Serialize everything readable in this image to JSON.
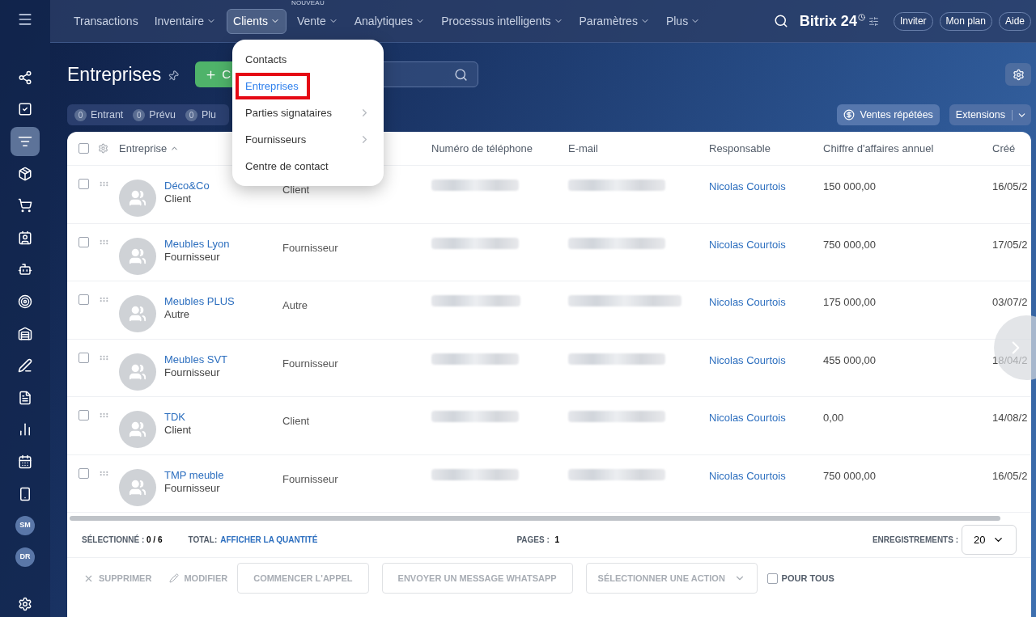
{
  "topnav": {
    "items": [
      {
        "label": "Transactions",
        "dropdown": false,
        "selected": false
      },
      {
        "label": "Inventaire",
        "dropdown": true,
        "selected": false
      },
      {
        "label": "Clients",
        "dropdown": true,
        "selected": true
      },
      {
        "label": "Vente",
        "dropdown": true,
        "selected": false,
        "badge": "NOUVEAU"
      },
      {
        "label": "Analytiques",
        "dropdown": true,
        "selected": false
      },
      {
        "label": "Processus intelligents",
        "dropdown": true,
        "selected": false
      },
      {
        "label": "Paramètres",
        "dropdown": true,
        "selected": false
      },
      {
        "label": "Plus",
        "dropdown": true,
        "selected": false
      }
    ],
    "logo": "Bitrix 24",
    "buttons": [
      "Inviter",
      "Mon plan",
      "Aide"
    ]
  },
  "sidebar": {
    "items": [
      {
        "kind": "icon",
        "selected": false
      },
      {
        "kind": "icon",
        "selected": false
      },
      {
        "kind": "icon",
        "selected": true
      },
      {
        "kind": "icon",
        "selected": false
      },
      {
        "kind": "icon",
        "selected": false
      },
      {
        "kind": "icon",
        "selected": false
      },
      {
        "kind": "icon",
        "selected": false
      },
      {
        "kind": "icon",
        "selected": false
      },
      {
        "kind": "icon",
        "selected": false
      },
      {
        "kind": "icon",
        "selected": false
      },
      {
        "kind": "icon",
        "selected": false
      },
      {
        "kind": "icon",
        "selected": false
      },
      {
        "kind": "icon",
        "selected": false
      },
      {
        "kind": "icon",
        "selected": false
      },
      {
        "kind": "avatar",
        "initials": "SM"
      },
      {
        "kind": "avatar",
        "initials": "DR"
      }
    ]
  },
  "page": {
    "title": "Entreprises",
    "create_button": "C",
    "filters": [
      {
        "count": "0",
        "label": "Entrant"
      },
      {
        "count": "0",
        "label": "Prévu"
      },
      {
        "count": "0",
        "label": "Plu"
      }
    ],
    "repeat_sales": "Ventes répétées",
    "extensions": "Extensions"
  },
  "menu": {
    "items": [
      {
        "label": "Contacts",
        "submenu": false,
        "selected": false
      },
      {
        "label": "Entreprises",
        "submenu": false,
        "selected": true
      },
      {
        "label": "Parties signataires",
        "submenu": true,
        "selected": false
      },
      {
        "label": "Fournisseurs",
        "submenu": true,
        "selected": false
      },
      {
        "label": "Centre de contact",
        "submenu": false,
        "selected": false
      }
    ]
  },
  "table": {
    "all_checked": false,
    "columns": [
      "Entreprise",
      "Numéro de téléphone",
      "E-mail",
      "Responsable",
      "Chiffre d'affaires annuel",
      "Créé"
    ],
    "rows": [
      {
        "name": "Déco&Co",
        "type": "Client",
        "column_2": "Client",
        "responsible": "Nicolas Courtois",
        "revenue": "150 000,00",
        "created": "16/05/2",
        "checked": false
      },
      {
        "name": "Meubles Lyon",
        "type": "Fournisseur",
        "column_2": "Fournisseur",
        "responsible": "Nicolas Courtois",
        "revenue": "750 000,00",
        "created": "17/05/2",
        "checked": false
      },
      {
        "name": "Meubles PLUS",
        "type": "Autre",
        "column_2": "Autre",
        "responsible": "Nicolas Courtois",
        "revenue": "175 000,00",
        "created": "03/07/2",
        "checked": false
      },
      {
        "name": "Meubles SVT",
        "type": "Fournisseur",
        "column_2": "Fournisseur",
        "responsible": "Nicolas Courtois",
        "revenue": "455 000,00",
        "created": "18/04/2",
        "checked": false
      },
      {
        "name": "TDK",
        "type": "Client",
        "column_2": "Client",
        "responsible": "Nicolas Courtois",
        "revenue": "0,00",
        "created": "14/08/2",
        "checked": false
      },
      {
        "name": "TMP meuble",
        "type": "Fournisseur",
        "column_2": "Fournisseur",
        "responsible": "Nicolas Courtois",
        "revenue": "750 000,00",
        "created": "16/05/2",
        "checked": false
      }
    ]
  },
  "footer": {
    "selected_label": "SÉLECTIONNÉ :",
    "selected_value": "0 / 6",
    "total_label": "TOTAL:",
    "total_link": "AFFICHER LA QUANTITÉ",
    "pages_label": "PAGES :",
    "pages_value": "1",
    "records_label": "ENREGISTREMENTS :",
    "records_value": "20"
  },
  "actions": {
    "delete": "SUPPRIMER",
    "edit": "MODIFIER",
    "call": "COMMENCER L'APPEL",
    "whatsapp": "ENVOYER UN MESSAGE WHATSAPP",
    "select_action": "SÉLECTIONNER UNE ACTION",
    "for_all": "POUR TOUS",
    "for_all_checked": false
  }
}
